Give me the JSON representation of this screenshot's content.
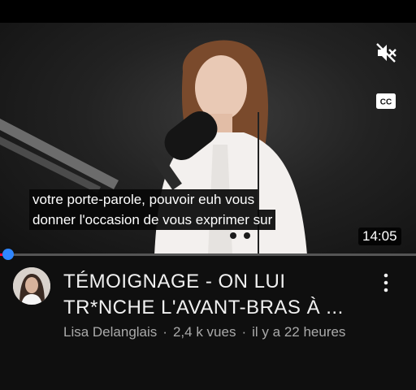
{
  "player": {
    "subtitle_lines": [
      "votre porte-parole, pouvoir euh vous",
      "donner l'occasion de vous exprimer sur"
    ],
    "duration": "14:05",
    "progress_fraction": 0.01,
    "mute_icon": "volume-off-icon",
    "cc_label": "CC"
  },
  "video": {
    "title": "TÉMOIGNAGE - ON LUI TR*NCHE L'AVANT-BRAS À ...",
    "channel": "Lisa Delanglais",
    "views": "2,4 k vues",
    "age": "il y a 22 heures",
    "separator": "·"
  },
  "colors": {
    "background": "#0f0f0f",
    "progress_knob": "#2f86ff",
    "meta_text": "#aaaaaa"
  }
}
